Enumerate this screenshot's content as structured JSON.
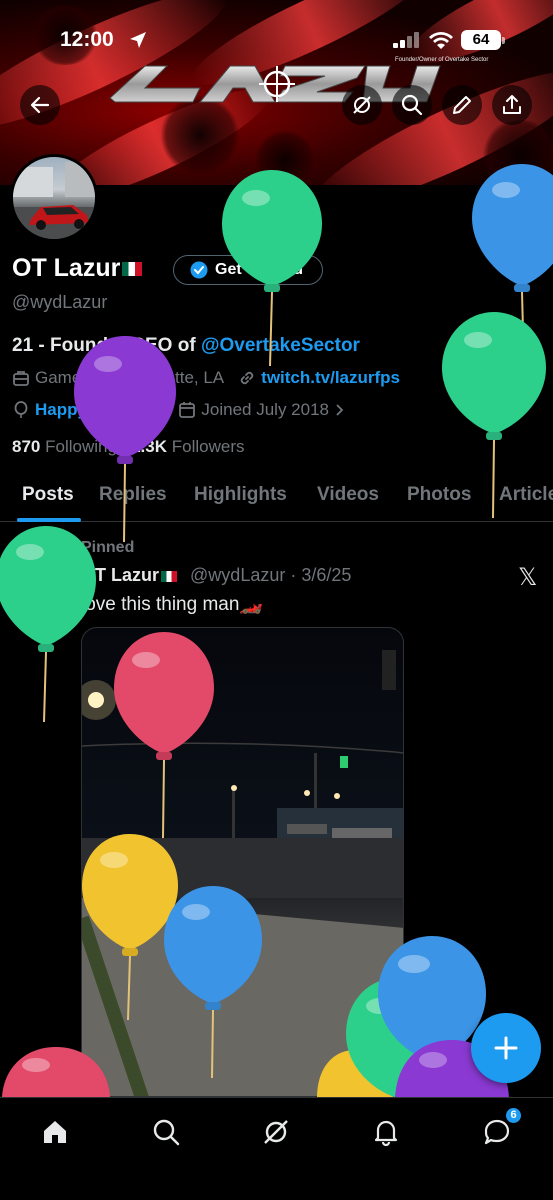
{
  "status_bar": {
    "time": "12:00",
    "battery": "64"
  },
  "banner": {
    "subtitle": "Founder/Owner of Overtake Sector"
  },
  "profile": {
    "name": "OT Lazur",
    "verify_label": "Get verified",
    "handle": "@wydLazur",
    "bio_prefix": "21 - Founder/CEO of ",
    "bio_mention": "@OvertakeSector",
    "category": "Gamer",
    "location": "Lafayette, LA",
    "website": "twitch.tv/lazurfps",
    "birthday": "Happy birthday!",
    "joined": "Joined July 2018",
    "following_count": "870",
    "following_label": "Following",
    "followers_count": "1.3K",
    "followers_label": "Followers"
  },
  "tabs": [
    {
      "label": "Posts",
      "active": true
    },
    {
      "label": "Replies"
    },
    {
      "label": "Highlights"
    },
    {
      "label": "Videos"
    },
    {
      "label": "Photos"
    },
    {
      "label": "Articles"
    }
  ],
  "post": {
    "pinned_label": "Pinned",
    "author": "OT Lazur",
    "meta": "@wydLazur · 3/6/25",
    "text": "love this thing man🏎️"
  },
  "nav": {
    "messages_badge": "6"
  },
  "colors": {
    "accent": "#1d9bf0",
    "background": "#000000",
    "muted": "#71767b"
  }
}
